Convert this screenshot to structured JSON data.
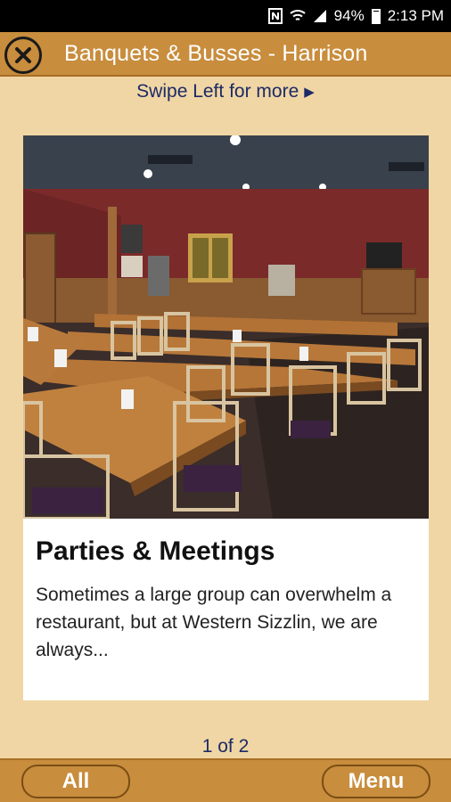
{
  "status_bar": {
    "battery": "94%",
    "time": "2:13 PM",
    "nfc_icon": "nfc-icon",
    "wifi_icon": "wifi-icon",
    "signal_icon": "signal-icon",
    "battery_icon": "battery-icon"
  },
  "header": {
    "title": "Banquets & Busses - Harrison",
    "close_icon": "close-icon"
  },
  "swipe_hint": {
    "text": "Swipe Left for more",
    "arrow": "▶"
  },
  "card": {
    "image_alt": "banquet-room-photo",
    "title": "Parties & Meetings",
    "description": "Sometimes a large group can overwhelm a restaurant, but at Western Sizzlin, we are always..."
  },
  "pager": {
    "text": "1 of 2"
  },
  "bottom_bar": {
    "all_label": "All",
    "menu_label": "Menu"
  },
  "colors": {
    "background": "#f0d6a4",
    "header": "#c88d3d",
    "accent_text": "#1c2a66"
  }
}
